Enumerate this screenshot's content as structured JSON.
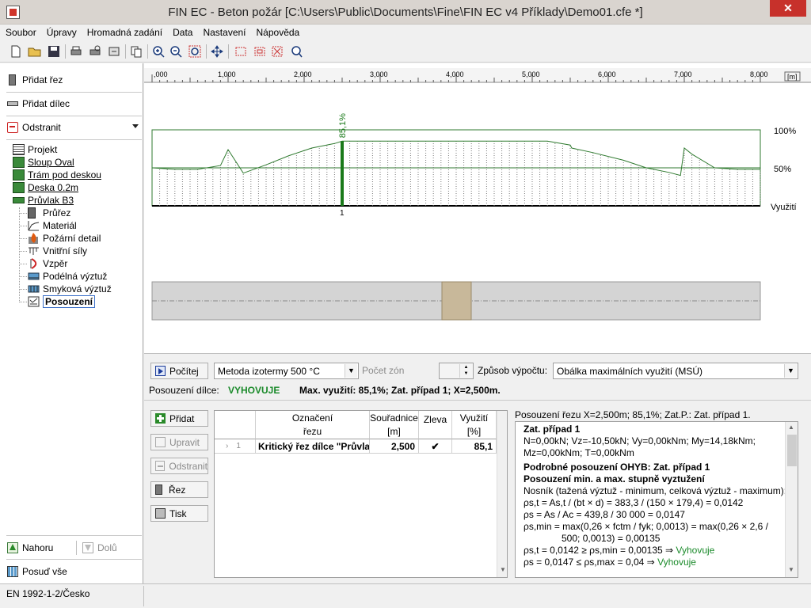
{
  "window": {
    "title": "FIN EC - Beton požár [C:\\Users\\Public\\Documents\\Fine\\FIN EC v4 Příklady\\Demo01.cfe *]",
    "close_glyph": "✕"
  },
  "menu": [
    "Soubor",
    "Úpravy",
    "Hromadná zadání",
    "Data",
    "Nastavení",
    "Nápověda"
  ],
  "toolbar_icons": [
    "new-icon",
    "open-icon",
    "save-icon",
    "print-icon",
    "print-preview-icon",
    "export-icon",
    "copy-icon",
    "zoom-in-icon",
    "zoom-out-icon",
    "zoom-window-icon",
    "pan-icon",
    "view-1-icon",
    "view-2-icon",
    "zoom-extents-icon",
    "zoom-previous-icon"
  ],
  "left": {
    "add_section": "Přidat řez",
    "add_member": "Přidat dílec",
    "remove": "Odstranit",
    "tree": [
      {
        "label": "Projekt",
        "underline": false,
        "level": 0
      },
      {
        "label": "Sloup Oval",
        "underline": true,
        "level": 0
      },
      {
        "label": "Trám pod deskou",
        "underline": true,
        "level": 0
      },
      {
        "label": "Deska 0.2m",
        "underline": true,
        "level": 0
      },
      {
        "label": "Průvlak B3",
        "underline": true,
        "level": 0
      },
      {
        "label": "Průřez",
        "underline": false,
        "level": 1
      },
      {
        "label": "Materiál",
        "underline": false,
        "level": 1
      },
      {
        "label": "Požární detail",
        "underline": false,
        "level": 1
      },
      {
        "label": "Vnitřní síly",
        "underline": false,
        "level": 1
      },
      {
        "label": "Vzpěr",
        "underline": false,
        "level": 1
      },
      {
        "label": "Podélná výztuž",
        "underline": false,
        "level": 1
      },
      {
        "label": "Smyková výztuž",
        "underline": false,
        "level": 1
      },
      {
        "label": "Posouzení",
        "underline": false,
        "level": 1,
        "selected": true
      }
    ],
    "up": "Nahoru",
    "down": "Dolů",
    "check_all": "Posuď vše"
  },
  "chart_data": {
    "type": "line",
    "x_ticks": [
      ",000",
      "1,000",
      "2,000",
      "3,000",
      "4,000",
      "5,000",
      "6,000",
      "7,000",
      "8,000"
    ],
    "x_unit": "[m]",
    "xlim": [
      0,
      8.0
    ],
    "ylim": [
      0,
      100
    ],
    "ref_labels": [
      "100%",
      "50%"
    ],
    "ylabel": "Využití",
    "critical_section": {
      "x": 2.5,
      "value": 85.1,
      "label": "85,1%",
      "index": "1"
    },
    "x": [
      0,
      0.3,
      0.6,
      0.9,
      1.0,
      1.2,
      1.5,
      1.8,
      2.1,
      2.4,
      2.5,
      2.8,
      3.2,
      3.6,
      4.0,
      4.4,
      4.8,
      5.2,
      5.5,
      5.52,
      5.8,
      6.2,
      6.5,
      6.8,
      6.95,
      7.0,
      7.1,
      7.4,
      7.7,
      8.0
    ],
    "values": [
      50,
      48,
      48,
      53,
      74,
      43,
      54,
      66,
      76,
      82,
      85.1,
      85.1,
      85.1,
      85.1,
      85.1,
      85.1,
      85.1,
      85.1,
      80,
      76,
      70,
      60,
      50,
      44,
      40,
      76,
      68,
      50,
      48,
      48
    ],
    "support_x": 4.0
  },
  "bottom": {
    "calculate": "Počítej",
    "method": "Metoda izotermy 500 °C",
    "zones_label": "Počet zón",
    "way_label": "Způsob výpočtu:",
    "way_value": "Obálka maximálních využití (MSÚ)",
    "member_check_label": "Posouzení dílce:",
    "member_check_value": "VYHOVUJE",
    "member_check_info": "Max. využití: 85,1%; Zat. případ 1; X=2,500m.",
    "add": "Přidat",
    "edit": "Upravit",
    "remove": "Odstranit",
    "section": "Řez",
    "print": "Tisk",
    "table": {
      "headers": [
        [
          "Označení",
          "řezu"
        ],
        [
          "Souřadnice",
          "[m]"
        ],
        [
          "Zleva",
          ""
        ],
        [
          "Využití",
          "[%]"
        ]
      ],
      "rows": [
        {
          "index": "1",
          "name": "Kritický řez dílce \"Průvla",
          "coord": "2,500",
          "left": "✔",
          "util": "85,1"
        }
      ]
    },
    "result_header": "Posouzení řezu X=2,500m; 85,1%; Zat.P.: Zat. případ 1.",
    "result": {
      "case_title": "Zat. případ 1",
      "forces_1": "N=0,00kN; Vz=-10,50kN; Vy=0,00kNm; My=14,18kNm;",
      "forces_2": "Mz=0,00kNm; T=0,00kNm",
      "detail_title": "Podrobné posouzení OHYB: Zat. případ 1",
      "minmax_title": "Posouzení min. a max. stupně vyztužení",
      "beam_note": "Nosník (tažená výztuž - minimum, celková výztuž - maximum):",
      "rho_st": "ρs,t     = As,t / (bt × d) = 383,3 / (150 × 179,4) = 0,0142",
      "rho_s": "ρs       = As / Ac = 439,8 / 30 000 = 0,0147",
      "rho_min_1": "ρs,min  = max(0,26 × fctm / fyk; 0,0013) = max(0,26 × 2,6 /",
      "rho_min_2": "500; 0,0013) = 0,00135",
      "check_1": "ρs,t  = 0,0142 ≥ ρs,min  = 0,00135  ⇒",
      "check_2": "ρs    = 0,0147 ≤ ρs,max = 0,04      ⇒",
      "ok": "Vyhovuje"
    }
  },
  "status": "EN 1992-1-2/Česko"
}
